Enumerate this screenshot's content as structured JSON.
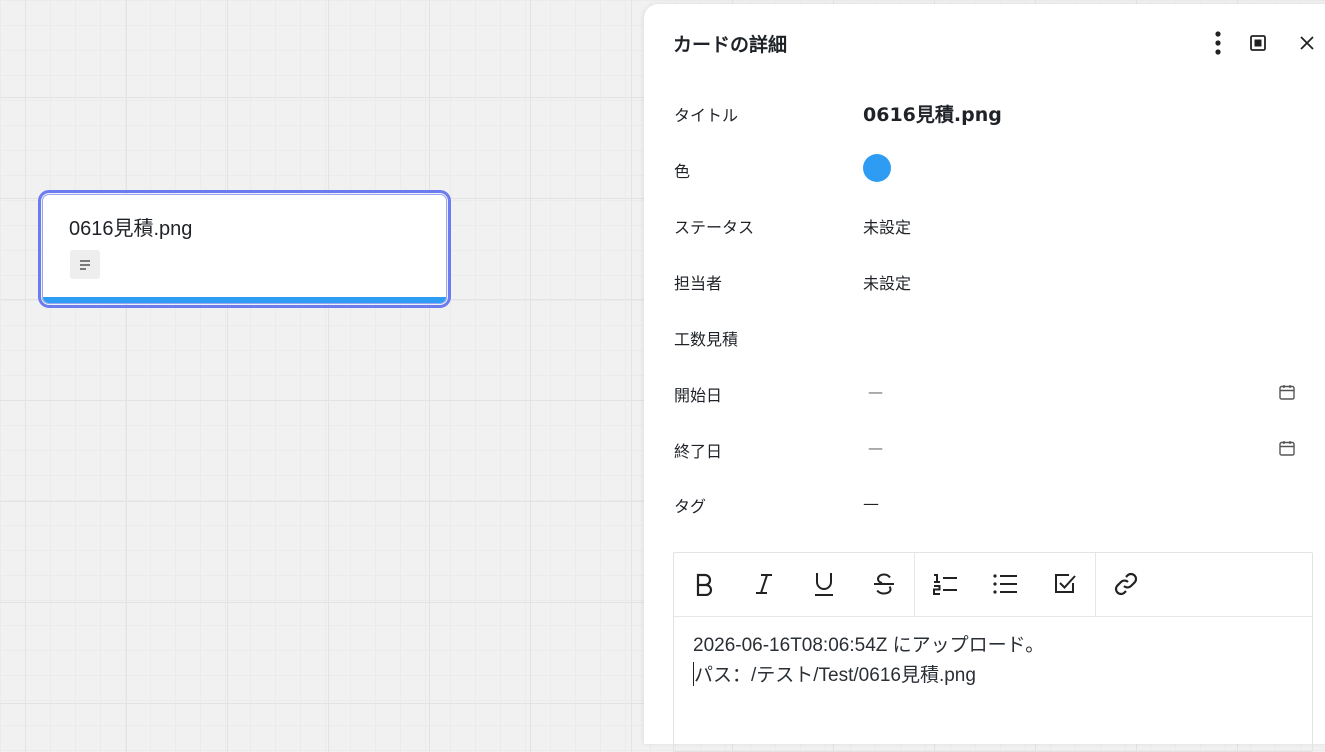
{
  "board": {
    "card": {
      "title": "0616見積.png",
      "color": "#2d9cf2",
      "selection_color": "#6b7cf0",
      "badge_icon": "description-lines-icon"
    }
  },
  "panel": {
    "title": "カードの詳細",
    "header_icons": [
      "more-vertical-icon",
      "maximize-icon",
      "close-icon"
    ],
    "fields": {
      "title": {
        "label": "タイトル",
        "value": "0616見積.png"
      },
      "color": {
        "label": "色",
        "value": "#2d9cf2"
      },
      "status": {
        "label": "ステータス",
        "value": "未設定"
      },
      "assignee": {
        "label": "担当者",
        "value": "未設定"
      },
      "estimate": {
        "label": "工数見積",
        "value": ""
      },
      "start_date": {
        "label": "開始日",
        "value": "—",
        "icon": "calendar-icon"
      },
      "end_date": {
        "label": "終了日",
        "value": "—",
        "icon": "calendar-icon"
      },
      "tags": {
        "label": "タグ",
        "value": "—"
      }
    },
    "editor": {
      "toolbar": [
        "bold-icon",
        "italic-icon",
        "underline-icon",
        "strikethrough-icon",
        "numbered-list-icon",
        "bullet-list-icon",
        "checkbox-icon",
        "link-icon"
      ],
      "line1": "2026-06-16T08:06:54Z にアップロード。",
      "line2": "パス：/テスト/Test/0616見積.png"
    }
  }
}
